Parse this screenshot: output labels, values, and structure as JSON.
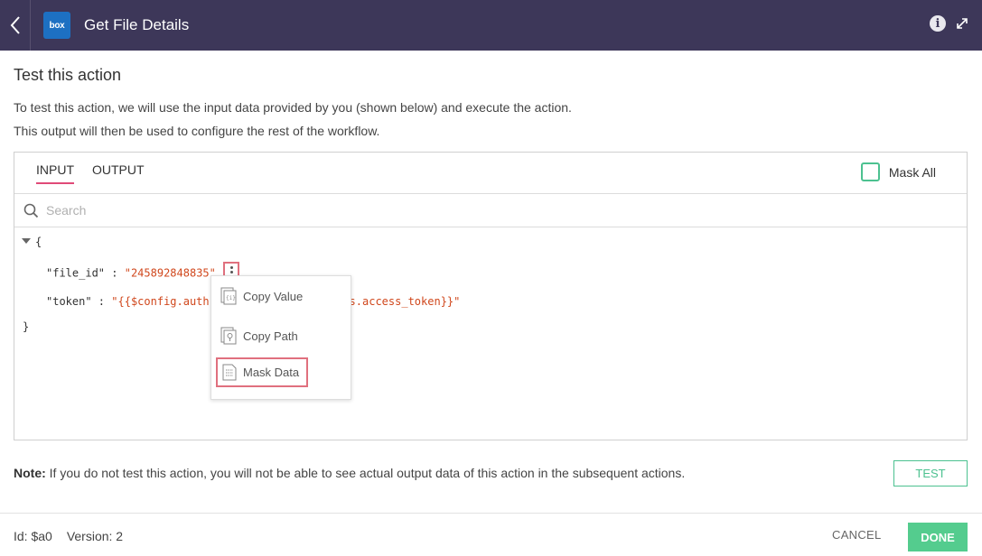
{
  "header": {
    "back_icon": "chevron-left-icon",
    "app_logo_text": "box",
    "title": "Get File Details",
    "info_icon": "i",
    "expand_icon": "expand-icon"
  },
  "intro": {
    "title": "Test this action",
    "line1": "To test this action, we will use the input data provided by you (shown below) and execute the action.",
    "line2": "This output will then be used to configure the rest of the workflow."
  },
  "panel": {
    "tabs": [
      {
        "label": "INPUT",
        "active": true
      },
      {
        "label": "OUTPUT",
        "active": false
      }
    ],
    "mask_all_label": "Mask All",
    "mask_all_checked": false,
    "search": {
      "placeholder": "Search",
      "value": ""
    },
    "json": {
      "open_brace": "{",
      "close_brace": "}",
      "rows": [
        {
          "key": "\"file_id\"",
          "sep": " : ",
          "value": "\"245892848835\""
        },
        {
          "key": "\"token\"",
          "sep": " : ",
          "value_start": "\"{{$config.auth.fl9",
          "value_end": "s.access_token}}\""
        }
      ]
    },
    "context_menu": {
      "items": [
        {
          "label": "Copy Value",
          "icon": "copy-value-icon"
        },
        {
          "label": "Copy Path",
          "icon": "copy-path-icon"
        },
        {
          "label": "Mask Data",
          "icon": "mask-data-icon"
        }
      ]
    }
  },
  "note": {
    "prefix": "Note:",
    "text": " If you do not test this action, you will not be able to see actual output data of this action in the subsequent actions."
  },
  "test_button": "TEST",
  "footer": {
    "id_text": "Id: $a0",
    "version_text": "Version: 2",
    "cancel_label": "CANCEL",
    "done_label": "DONE"
  },
  "colors": {
    "header_bg": "#3d3759",
    "accent_green": "#54cc8e",
    "tab_underline": "#e04a78",
    "json_value": "#d0471c",
    "highlight_border": "#e0707e"
  }
}
